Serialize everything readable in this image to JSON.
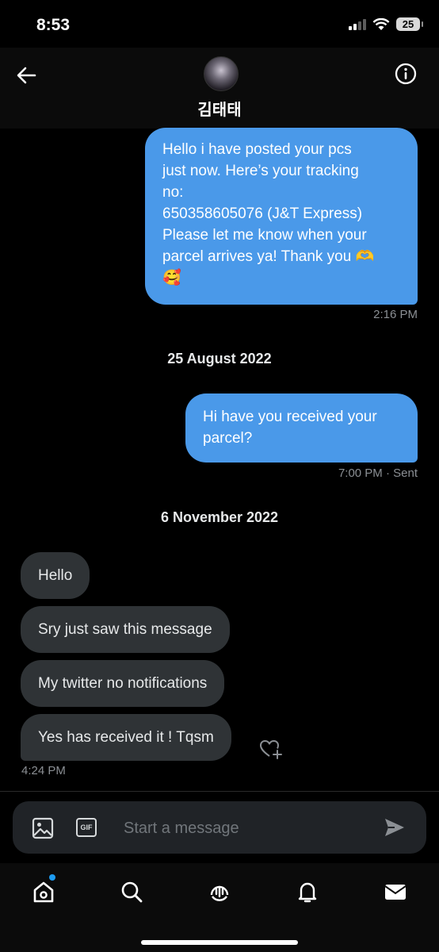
{
  "status_bar": {
    "time": "8:53",
    "battery": "25"
  },
  "header": {
    "contact_name": "김태태"
  },
  "messages": {
    "sent_1": {
      "lines": [
        "Hello i have posted your pcs",
        "just now. Here’s your tracking",
        "no:",
        "650358605076 (J&T Express)",
        "Please let me know when your",
        "parcel arrives ya! Thank you 🫶",
        "🥰"
      ],
      "time": "2:16 PM"
    },
    "date_1": "25 August 2022",
    "sent_2": {
      "lines": [
        "Hi have you received your",
        "parcel?"
      ],
      "time": "7:00 PM · Sent"
    },
    "date_2": "6 November 2022",
    "received": [
      "Hello",
      "Sry just saw this message",
      "My twitter no notifications",
      "Yes has received it ! Tqsm"
    ],
    "received_time": "4:24 PM"
  },
  "composer": {
    "placeholder": "Start a message",
    "gif_label": "GIF"
  },
  "tabs": [
    "home-icon",
    "search-icon",
    "spaces-icon",
    "notifications-icon",
    "messages-icon"
  ],
  "colors": {
    "sent_bubble": "#4a99e9",
    "received_bubble": "#2f3336",
    "accent": "#1d9bf0"
  }
}
